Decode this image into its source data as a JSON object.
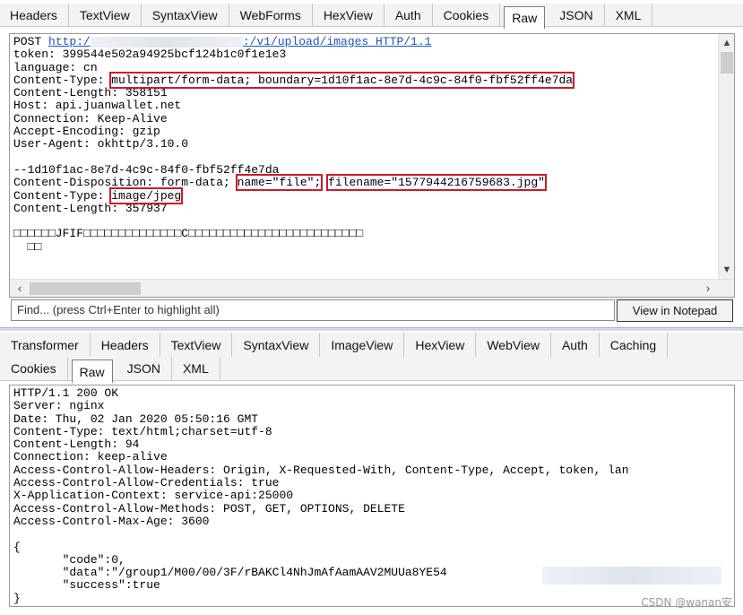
{
  "request_tabs": [
    "Headers",
    "TextView",
    "SyntaxView",
    "WebForms",
    "HexView",
    "Auth",
    "Cookies",
    "Raw",
    "JSON",
    "XML"
  ],
  "request_active_tab": "Raw",
  "request": {
    "line_method": "POST ",
    "line_url_prefix": "http:/",
    "line_url_suffix": ":/v1/upload/images HTTP/1.1",
    "token": "token: 399544e502a94925bcf124b1c0f1e1e3",
    "language": "language: cn",
    "content_type_key": "Content-Type: ",
    "content_type_val": "multipart/form-data; boundary=1d10f1ac-8e7d-4c9c-84f0-fbf52ff4e7da",
    "content_length": "Content-Length: 358151",
    "host": "Host: api.juanwallet.net",
    "connection": "Connection: Keep-Alive",
    "accept_encoding": "Accept-Encoding: gzip",
    "user_agent": "User-Agent: okhttp/3.10.0",
    "boundary_line": "--1d10f1ac-8e7d-4c9c-84f0-fbf52ff4e7da",
    "disposition_key": "Content-Disposition: form-data; ",
    "disposition_name": "name=\"file\";",
    "disposition_filename": "filename=\"1577944216759683.jpg\"",
    "part_type_key": "Content-Type: ",
    "part_type_val": "image/jpeg",
    "part_length": "Content-Length: 357937",
    "binary_line_1": "□□□□□□JFIF□□□□□□□□□□□□□□C□□□□□□□□□□□□□□□□□□□□□□□□□",
    "binary_line_2": "  □□"
  },
  "find": {
    "placeholder": "Find... (press Ctrl+Enter to highlight all)",
    "button_label": "View in Notepad"
  },
  "response_tabs_row1": [
    "Transformer",
    "Headers",
    "TextView",
    "SyntaxView",
    "ImageView",
    "HexView",
    "WebView",
    "Auth",
    "Caching"
  ],
  "response_tabs_row2": [
    "Cookies",
    "Raw",
    "JSON",
    "XML"
  ],
  "response_active_tab": "Raw",
  "response": {
    "lines": [
      "HTTP/1.1 200 OK",
      "Server: nginx",
      "Date: Thu, 02 Jan 2020 05:50:16 GMT",
      "Content-Type: text/html;charset=utf-8",
      "Content-Length: 94",
      "Connection: keep-alive",
      "Access-Control-Allow-Headers: Origin, X-Requested-With, Content-Type, Accept, token, lan",
      "Access-Control-Allow-Credentials: true",
      "X-Application-Context: service-api:25000",
      "Access-Control-Allow-Methods: POST, GET, OPTIONS, DELETE",
      "Access-Control-Max-Age: 3600",
      "",
      "{",
      "       \"code\":0,",
      "       \"data\":\"/group1/M00/00/3F/rBAKCl4NhJmAfAamAAV2MUUa8YE54",
      "       \"success\":true",
      "}"
    ]
  },
  "watermark": "CSDN @wanan安",
  "colors": {
    "highlight_box": "#d0192b",
    "link": "#1a55c8"
  }
}
